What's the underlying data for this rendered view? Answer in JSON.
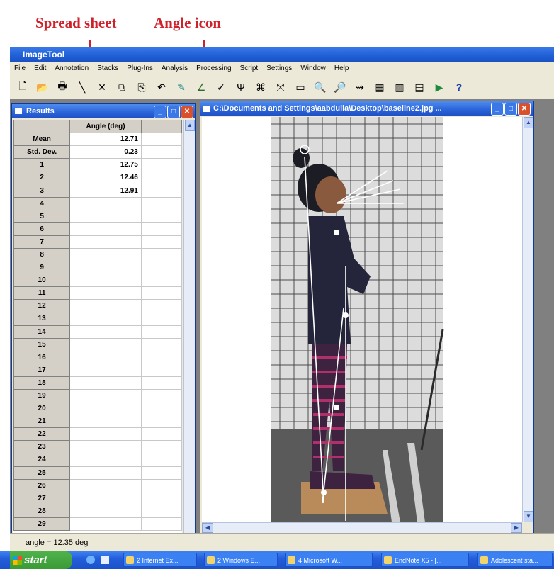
{
  "annotations": {
    "spreadsheet_label": "Spread sheet",
    "angle_icon_label": "Angle icon",
    "color": "#d0202a"
  },
  "app": {
    "title": "ImageTool",
    "menu": [
      "File",
      "Edit",
      "Annotation",
      "Stacks",
      "Plug-Ins",
      "Analysis",
      "Processing",
      "Script",
      "Settings",
      "Window",
      "Help"
    ],
    "toolbar_icons": [
      "new-icon",
      "open-icon",
      "print-icon",
      "line-tool-icon",
      "cross-icon",
      "frame-icon",
      "copy-icon",
      "undo-icon",
      "pencil-icon",
      "angle-tool-icon",
      "point-tool-icon",
      "calibrate-icon",
      "measure-icon",
      "distance-icon",
      "image-icon",
      "zoom-in-icon",
      "zoom-out-icon",
      "link-icon",
      "grid-icon",
      "histogram-icon",
      "chart-icon",
      "play-icon",
      "help-icon"
    ]
  },
  "results_window": {
    "title": "Results",
    "column_header": "Angle (deg)",
    "rows": [
      {
        "label": "Mean",
        "value": "12.71"
      },
      {
        "label": "Std. Dev.",
        "value": "0.23"
      },
      {
        "label": "1",
        "value": "12.75"
      },
      {
        "label": "2",
        "value": "12.46"
      },
      {
        "label": "3",
        "value": "12.91"
      },
      {
        "label": "4",
        "value": ""
      },
      {
        "label": "5",
        "value": ""
      },
      {
        "label": "6",
        "value": ""
      },
      {
        "label": "7",
        "value": ""
      },
      {
        "label": "8",
        "value": ""
      },
      {
        "label": "9",
        "value": ""
      },
      {
        "label": "10",
        "value": ""
      },
      {
        "label": "11",
        "value": ""
      },
      {
        "label": "12",
        "value": ""
      },
      {
        "label": "13",
        "value": ""
      },
      {
        "label": "14",
        "value": ""
      },
      {
        "label": "15",
        "value": ""
      },
      {
        "label": "16",
        "value": ""
      },
      {
        "label": "17",
        "value": ""
      },
      {
        "label": "18",
        "value": ""
      },
      {
        "label": "19",
        "value": ""
      },
      {
        "label": "20",
        "value": ""
      },
      {
        "label": "21",
        "value": ""
      },
      {
        "label": "22",
        "value": ""
      },
      {
        "label": "23",
        "value": ""
      },
      {
        "label": "24",
        "value": ""
      },
      {
        "label": "25",
        "value": ""
      },
      {
        "label": "26",
        "value": ""
      },
      {
        "label": "27",
        "value": ""
      },
      {
        "label": "28",
        "value": ""
      },
      {
        "label": "29",
        "value": ""
      }
    ]
  },
  "image_window": {
    "title": "C:\\Documents and Settings\\aabdulla\\Desktop\\baseline2.jpg ..."
  },
  "status_bar": {
    "text": "angle = 12.35 deg"
  },
  "taskbar": {
    "start_label": "start",
    "tasks": [
      "2 Internet Ex...",
      "2 Windows E...",
      "4 Microsoft W...",
      "EndNote X5 - [...",
      "Adolescent sta..."
    ]
  }
}
